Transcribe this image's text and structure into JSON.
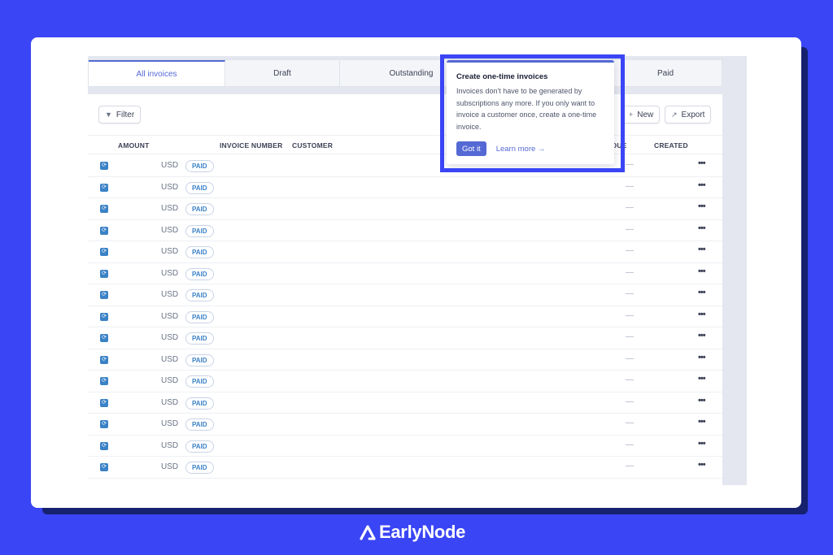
{
  "tabs": [
    {
      "label": "All invoices",
      "active": true
    },
    {
      "label": "Draft",
      "active": false
    },
    {
      "label": "Outstanding",
      "active": false
    },
    {
      "label": "",
      "active": false
    },
    {
      "label": "Paid",
      "active": false
    }
  ],
  "toolbar": {
    "filter_label": "Filter",
    "new_label": "New",
    "export_label": "Export"
  },
  "table": {
    "headers": {
      "amount": "AMOUNT",
      "invoice_number": "INVOICE NUMBER",
      "customer": "CUSTOMER",
      "due": "DUE",
      "created": "CREATED"
    },
    "rows": [
      {
        "currency": "USD",
        "status": "PAID"
      },
      {
        "currency": "USD",
        "status": "PAID"
      },
      {
        "currency": "USD",
        "status": "PAID"
      },
      {
        "currency": "USD",
        "status": "PAID"
      },
      {
        "currency": "USD",
        "status": "PAID"
      },
      {
        "currency": "USD",
        "status": "PAID"
      },
      {
        "currency": "USD",
        "status": "PAID"
      },
      {
        "currency": "USD",
        "status": "PAID"
      },
      {
        "currency": "USD",
        "status": "PAID"
      },
      {
        "currency": "USD",
        "status": "PAID"
      },
      {
        "currency": "USD",
        "status": "PAID"
      },
      {
        "currency": "USD",
        "status": "PAID"
      },
      {
        "currency": "USD",
        "status": "PAID"
      },
      {
        "currency": "USD",
        "status": "PAID"
      },
      {
        "currency": "USD",
        "status": "PAID"
      }
    ],
    "empty_value": "—"
  },
  "popover": {
    "title": "Create one-time invoices",
    "body": "Invoices don't have to be generated by subscriptions any more. If you only want to invoice a customer once, create a one-time invoice.",
    "primary_button": "Got it",
    "link": "Learn more →"
  },
  "brand": {
    "name": "EarlyNode"
  },
  "colors": {
    "background": "#3a45f5",
    "accent": "#5469d4",
    "paid_badge": "#3b82c6"
  }
}
